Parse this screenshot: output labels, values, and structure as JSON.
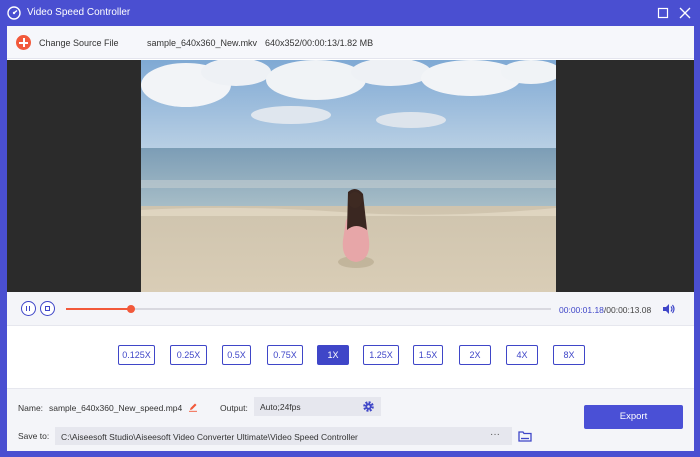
{
  "window": {
    "title": "Video Speed Controller",
    "accent_color": "#4a4fd1",
    "icons": {
      "app": "speedometer-icon",
      "restore": "restore-icon",
      "close": "close-icon"
    }
  },
  "source": {
    "change_label": "Change Source File",
    "file_name": "sample_640x360_New.mkv",
    "file_info": "640x352/00:00:13/1.82 MB",
    "add_icon": "plus-circle-icon"
  },
  "player": {
    "current_time": "00:00:01.18",
    "total_time": "/00:00:13.08",
    "progress": 0.135,
    "icons": {
      "pause": "pause-icon",
      "stop": "stop-icon",
      "volume": "volume-icon"
    }
  },
  "speeds": {
    "options": [
      "0.125X",
      "0.25X",
      "0.5X",
      "0.75X",
      "1X",
      "1.25X",
      "1.5X",
      "2X",
      "4X",
      "8X"
    ],
    "selected": "1X"
  },
  "output": {
    "name_label": "Name:",
    "name_value": "sample_640x360_New_speed.mp4",
    "output_label": "Output:",
    "output_value": "Auto;24fps",
    "save_label": "Save to:",
    "save_path": "C:\\Aiseesoft Studio\\Aiseesoft Video Converter Ultimate\\Video Speed Controller",
    "browse_label": "···",
    "export_label": "Export",
    "icons": {
      "edit": "pencil-icon",
      "settings": "gear-icon",
      "folder": "folder-icon"
    }
  },
  "colors": {
    "accent": "#3f46c8",
    "orange": "#f2593b",
    "export": "#4a50d6"
  }
}
